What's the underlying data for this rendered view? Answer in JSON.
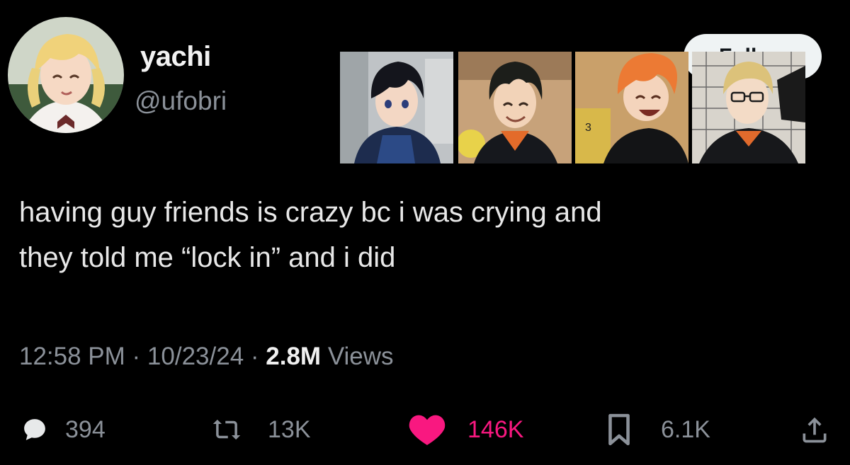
{
  "user": {
    "display_name": "yachi",
    "handle": "@ufobri",
    "avatar_icon": "anime-girl-avatar"
  },
  "follow_button": {
    "label": "Follow"
  },
  "pinned_images": [
    {
      "name": "character-dark-hair-hoodie"
    },
    {
      "name": "character-freckles-smiling"
    },
    {
      "name": "character-orange-hair-laughing"
    },
    {
      "name": "character-blond-glasses"
    }
  ],
  "tweet": {
    "text_line1": "having guy friends is crazy bc i was crying and",
    "text_line2": "they told me “lock in” and i did"
  },
  "meta": {
    "time": "12:58 PM",
    "sep1": " · ",
    "date": "10/23/24",
    "sep2": " · ",
    "views_count": "2.8M",
    "views_label": " Views"
  },
  "actions": {
    "replies": "394",
    "reposts": "13K",
    "likes": "146K",
    "bookmarks": "6.1K"
  },
  "colors": {
    "background": "#000000",
    "text": "#e7e9ea",
    "muted": "#8b9199",
    "like": "#f91880"
  }
}
